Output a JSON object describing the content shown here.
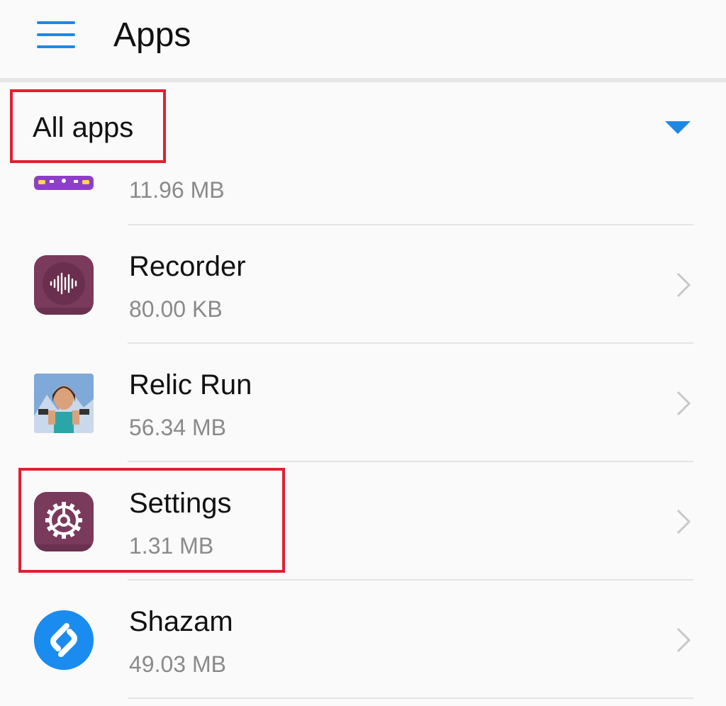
{
  "header": {
    "title": "Apps",
    "menu_icon": "hamburger-menu-icon"
  },
  "filter": {
    "label": "All apps",
    "dropdown_icon": "dropdown-triangle-icon"
  },
  "apps": [
    {
      "name": "",
      "size": "11.96 MB",
      "icon": "bus-app-icon"
    },
    {
      "name": "Recorder",
      "size": "80.00 KB",
      "icon": "recorder-icon"
    },
    {
      "name": "Relic Run",
      "size": "56.34 MB",
      "icon": "relic-run-icon"
    },
    {
      "name": "Settings",
      "size": "1.31 MB",
      "icon": "settings-gear-icon"
    },
    {
      "name": "Shazam",
      "size": "49.03 MB",
      "icon": "shazam-icon"
    }
  ],
  "colors": {
    "accent": "#1e88e5",
    "highlight": "#e02030",
    "recorder_bg": "#7a3a5c",
    "settings_bg": "#7a3a5c",
    "shazam_bg": "#1a8cf0",
    "bus_bg": "#8e3fc9"
  }
}
